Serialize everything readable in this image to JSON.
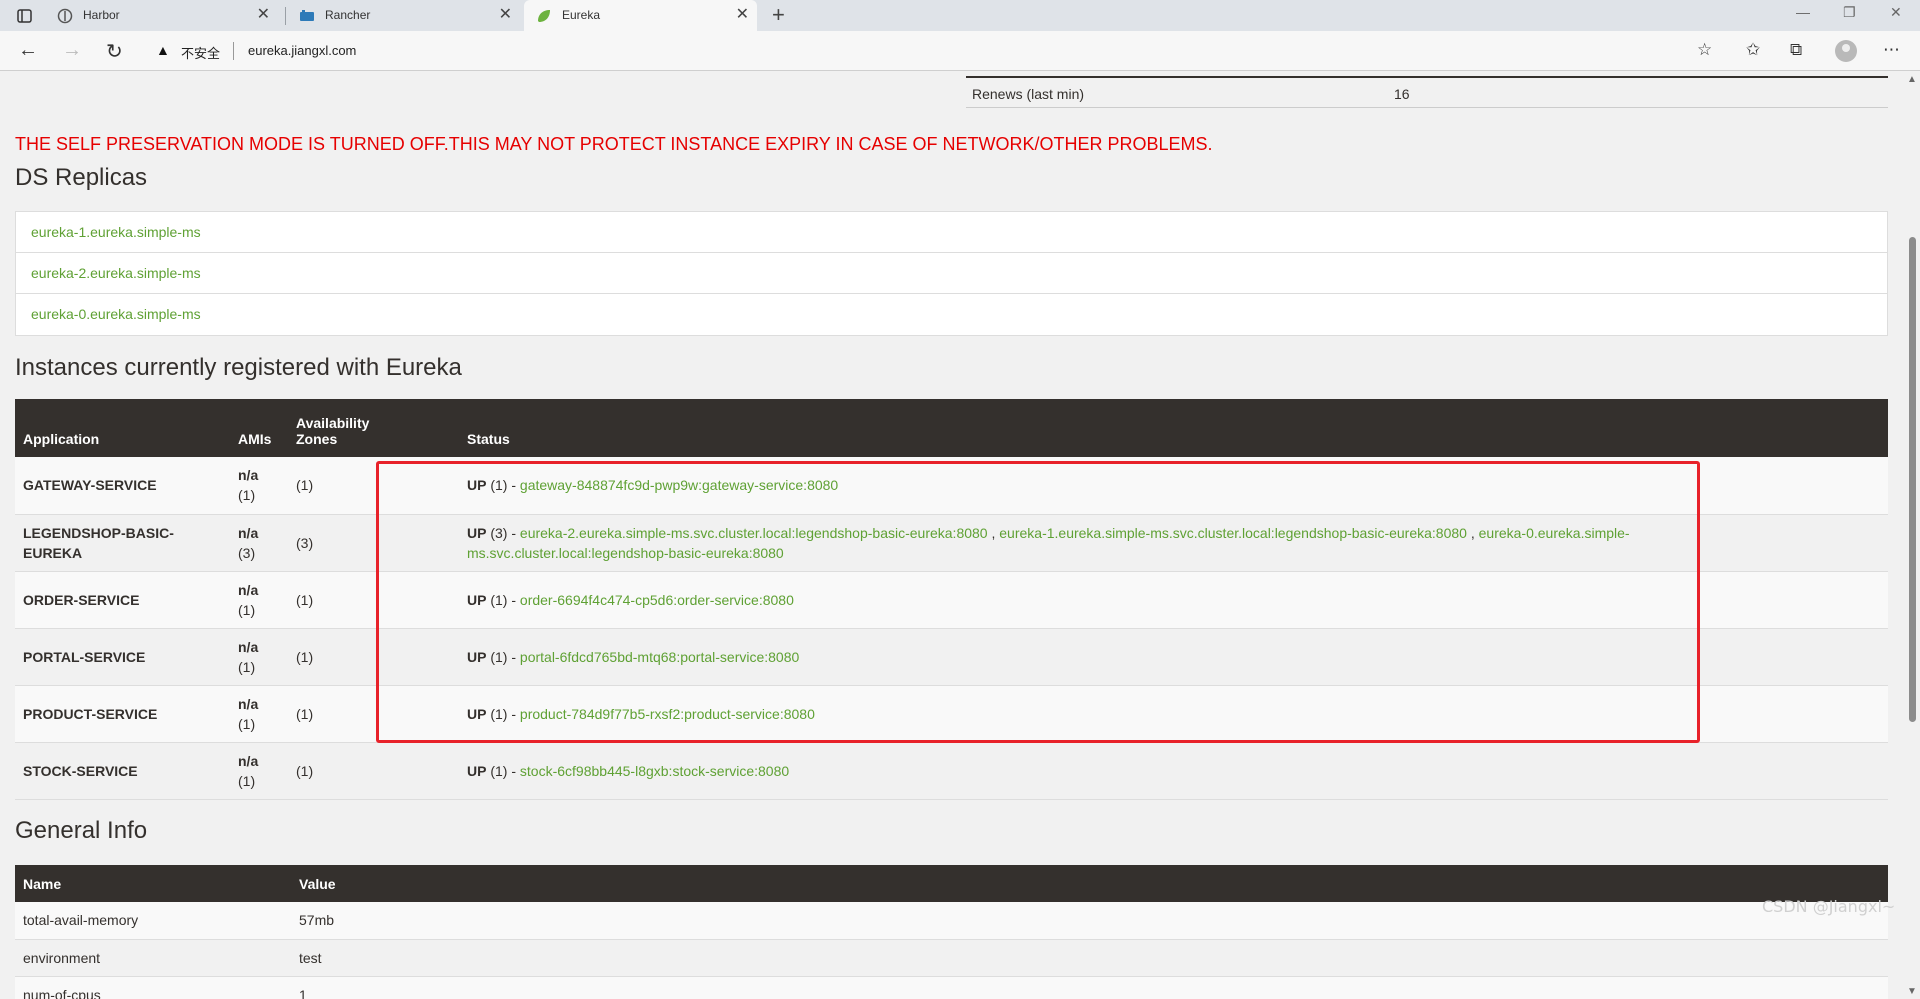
{
  "browser": {
    "tabs": [
      {
        "label": "Harbor"
      },
      {
        "label": "Rancher"
      },
      {
        "label": "Eureka",
        "active": true
      }
    ],
    "new_tab": "+",
    "security_label": "不安全",
    "url": "eureka.jiangxl.com",
    "window_controls": {
      "minimize": "—",
      "restore": "❐",
      "close": "✕"
    }
  },
  "stats": {
    "renews_label": "Renews (last min)",
    "renews_value": "16"
  },
  "warning": "THE SELF PRESERVATION MODE IS TURNED OFF.THIS MAY NOT PROTECT INSTANCE EXPIRY IN CASE OF NETWORK/OTHER PROBLEMS.",
  "ds_replicas": {
    "title": "DS Replicas",
    "items": [
      "eureka-1.eureka.simple-ms",
      "eureka-2.eureka.simple-ms",
      "eureka-0.eureka.simple-ms"
    ]
  },
  "instances": {
    "title": "Instances currently registered with Eureka",
    "headers": {
      "application": "Application",
      "amis": "AMIs",
      "zones_line1": "Availability",
      "zones_line2": "Zones",
      "status": "Status"
    },
    "rows": [
      {
        "app": "GATEWAY-SERVICE",
        "amis": "n/a",
        "amis_count": "(1)",
        "zones": "(1)",
        "status": "UP",
        "status_count": "(1) -",
        "links": [
          "gateway-848874fc9d-pwp9w:gateway-service:8080"
        ]
      },
      {
        "app": "LEGENDSHOP-BASIC-EUREKA",
        "amis": "n/a",
        "amis_count": "(3)",
        "zones": "(3)",
        "status": "UP",
        "status_count": "(3) -",
        "links": [
          "eureka-2.eureka.simple-ms.svc.cluster.local:legendshop-basic-eureka:8080",
          "eureka-1.eureka.simple-ms.svc.cluster.local:legendshop-basic-eureka:8080",
          "eureka-0.eureka.simple-ms.svc.cluster.local:legendshop-basic-eureka:8080"
        ]
      },
      {
        "app": "ORDER-SERVICE",
        "amis": "n/a",
        "amis_count": "(1)",
        "zones": "(1)",
        "status": "UP",
        "status_count": "(1) -",
        "links": [
          "order-6694f4c474-cp5d6:order-service:8080"
        ]
      },
      {
        "app": "PORTAL-SERVICE",
        "amis": "n/a",
        "amis_count": "(1)",
        "zones": "(1)",
        "status": "UP",
        "status_count": "(1) -",
        "links": [
          "portal-6fdcd765bd-mtq68:portal-service:8080"
        ]
      },
      {
        "app": "PRODUCT-SERVICE",
        "amis": "n/a",
        "amis_count": "(1)",
        "zones": "(1)",
        "status": "UP",
        "status_count": "(1) -",
        "links": [
          "product-784d9f77b5-rxsf2:product-service:8080"
        ]
      },
      {
        "app": "STOCK-SERVICE",
        "amis": "n/a",
        "amis_count": "(1)",
        "zones": "(1)",
        "status": "UP",
        "status_count": "(1) -",
        "links": [
          "stock-6cf98bb445-l8gxb:stock-service:8080"
        ]
      }
    ]
  },
  "general_info": {
    "title": "General Info",
    "headers": {
      "name": "Name",
      "value": "Value"
    },
    "rows": [
      {
        "name": "total-avail-memory",
        "value": "57mb"
      },
      {
        "name": "environment",
        "value": "test"
      },
      {
        "name": "num-of-cpus",
        "value": "1"
      }
    ]
  },
  "watermark": "CSDN @Jiangxl~",
  "colors": {
    "header_bg": "#34302d",
    "link": "#5fa134",
    "warning": "#e60000",
    "highlight": "#e8222a",
    "page_bg": "#f1f1f1"
  }
}
